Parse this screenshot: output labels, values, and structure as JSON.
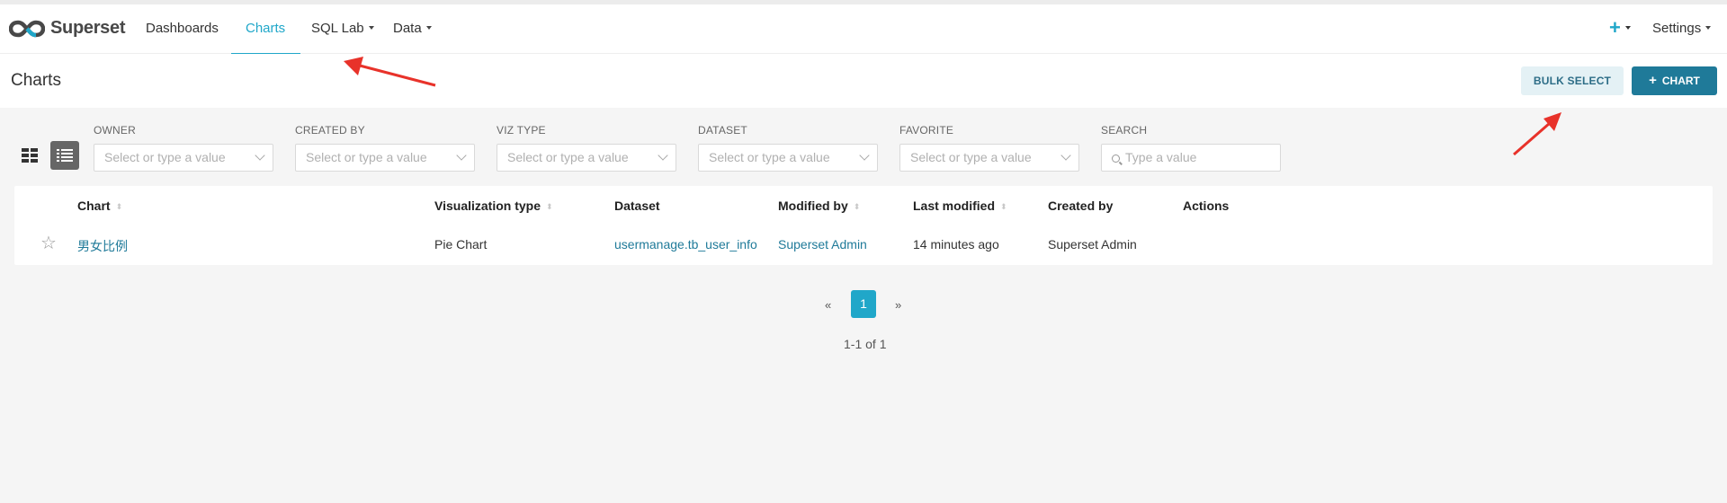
{
  "app": {
    "brand": "Superset",
    "nav": [
      {
        "label": "Dashboards"
      },
      {
        "label": "Charts",
        "active": true
      },
      {
        "label": "SQL Lab",
        "dropdown": true
      },
      {
        "label": "Data",
        "dropdown": true
      }
    ],
    "right_nav": {
      "plus_icon": "plus-icon",
      "settings": "Settings"
    },
    "accent": "#20a7c9",
    "primary": "#1f7a99"
  },
  "page": {
    "title": "Charts",
    "bulk_select": "BULK SELECT",
    "add_chart": "CHART",
    "add_chart_icon": "+"
  },
  "filters": [
    {
      "label": "OWNER",
      "placeholder": "Select or type a value"
    },
    {
      "label": "CREATED BY",
      "placeholder": "Select or type a value"
    },
    {
      "label": "VIZ TYPE",
      "placeholder": "Select or type a value"
    },
    {
      "label": "DATASET",
      "placeholder": "Select or type a value"
    },
    {
      "label": "FAVORITE",
      "placeholder": "Select or type a value"
    },
    {
      "label": "SEARCH",
      "placeholder": "Type a value"
    }
  ],
  "table": {
    "columns": [
      "Chart",
      "Visualization type",
      "Dataset",
      "Modified by",
      "Last modified",
      "Created by",
      "Actions"
    ],
    "rows": [
      {
        "chart": "男女比例",
        "viz_type": "Pie Chart",
        "dataset": "usermanage.tb_user_info",
        "modified_by": "Superset Admin",
        "last_modified": "14 minutes ago",
        "created_by": "Superset Admin",
        "favorite": false
      }
    ]
  },
  "pagination": {
    "prev": "«",
    "current": "1",
    "next": "»",
    "summary": "1-1 of 1"
  },
  "annotations": {
    "arrow_color": "#e8322a"
  }
}
